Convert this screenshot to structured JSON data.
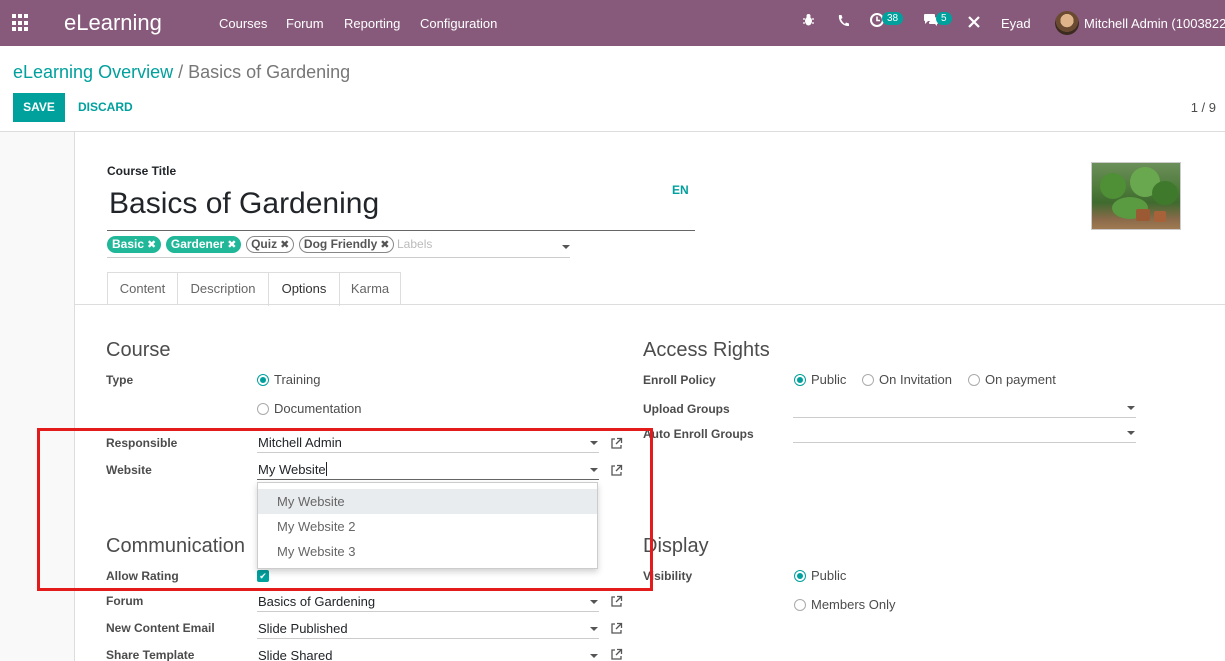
{
  "navbar": {
    "brand": "eLearning",
    "menu": [
      "Courses",
      "Forum",
      "Reporting",
      "Configuration"
    ],
    "activity_count": "38",
    "messages_count": "5",
    "company": "Eyad",
    "user": "Mitchell Admin (1003822"
  },
  "breadcrumb": {
    "parent": "eLearning Overview",
    "separator": "/",
    "current": "Basics of Gardening"
  },
  "actions": {
    "save": "SAVE",
    "discard": "DISCARD"
  },
  "pager": "1 / 9",
  "course": {
    "title_label": "Course Title",
    "title": "Basics of Gardening",
    "lang": "EN",
    "tags": [
      {
        "label": "Basic",
        "style": "filled"
      },
      {
        "label": "Gardener",
        "style": "filled"
      },
      {
        "label": "Quiz",
        "style": "outline"
      },
      {
        "label": "Dog Friendly",
        "style": "outline"
      }
    ],
    "tags_placeholder": "Labels"
  },
  "tabs": [
    "Content",
    "Description",
    "Options",
    "Karma"
  ],
  "active_tab": "Options",
  "course_section": {
    "title": "Course",
    "type_label": "Type",
    "type_options": [
      "Training",
      "Documentation"
    ],
    "type_selected": "Training",
    "responsible_label": "Responsible",
    "responsible_value": "Mitchell Admin",
    "website_label": "Website",
    "website_value": "My Website"
  },
  "website_dropdown": {
    "options": [
      "My Website",
      "My Website 2",
      "My Website 3"
    ],
    "highlighted": "My Website"
  },
  "access_section": {
    "title": "Access Rights",
    "enroll_label": "Enroll Policy",
    "enroll_options": [
      "Public",
      "On Invitation",
      "On payment"
    ],
    "enroll_selected": "Public",
    "upload_groups_label": "Upload Groups",
    "auto_enroll_label": "Auto Enroll Groups"
  },
  "communication_section": {
    "title": "Communication",
    "allow_rating_label": "Allow Rating",
    "allow_rating": true,
    "forum_label": "Forum",
    "forum_value": "Basics of Gardening",
    "new_content_label": "New Content Email",
    "new_content_value": "Slide Published",
    "share_template_label": "Share Template",
    "share_template_value": "Slide Shared"
  },
  "display_section": {
    "title": "Display",
    "visibility_label": "Visibility",
    "visibility_options": [
      "Public",
      "Members Only"
    ],
    "visibility_selected": "Public"
  },
  "colors": {
    "navbar": "#875a7b",
    "accent": "#00a09d",
    "tag_filled": "#21b799",
    "highlight_box": "#e31b1b"
  }
}
